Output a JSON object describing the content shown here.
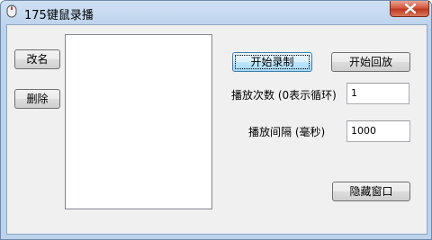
{
  "window": {
    "title": "175键鼠录播"
  },
  "buttons": {
    "rename": "改名",
    "delete": "删除",
    "start_record": "开始录制",
    "start_playback": "开始回放",
    "hide_window": "隐藏窗口"
  },
  "fields": {
    "play_count_label": "播放次数 (0表示循环)",
    "play_count_value": "1",
    "play_interval_label": "播放间隔 (毫秒)",
    "play_interval_value": "1000"
  },
  "recordings_list": []
}
